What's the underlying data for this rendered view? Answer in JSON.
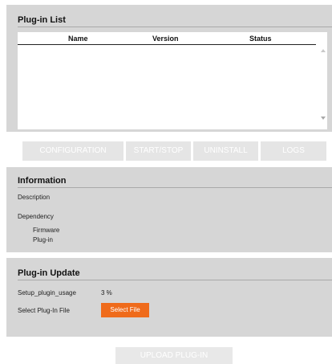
{
  "plugin_list": {
    "title": "Plug-in List",
    "columns": [
      "Name",
      "Version",
      "Status"
    ],
    "rows": []
  },
  "actions": [
    "CONFIGURATION",
    "START/STOP",
    "UNINSTALL",
    "LOGS"
  ],
  "information": {
    "title": "Information",
    "description_label": "Description",
    "dependency_label": "Dependency",
    "firmware_label": "Firmware",
    "plugin_label": "Plug-in"
  },
  "update": {
    "title": "Plug-in Update",
    "usage_label": "Setup_plugin_usage",
    "usage_value": "3 %",
    "file_label": "Select Plug-In File",
    "select_button": "Select File"
  },
  "upload_button": "UPLOAD PLUG-IN",
  "colors": {
    "accent": "#ef6b1b",
    "panel": "#d6d6d6",
    "disabled_button": "#e5e5e5"
  }
}
